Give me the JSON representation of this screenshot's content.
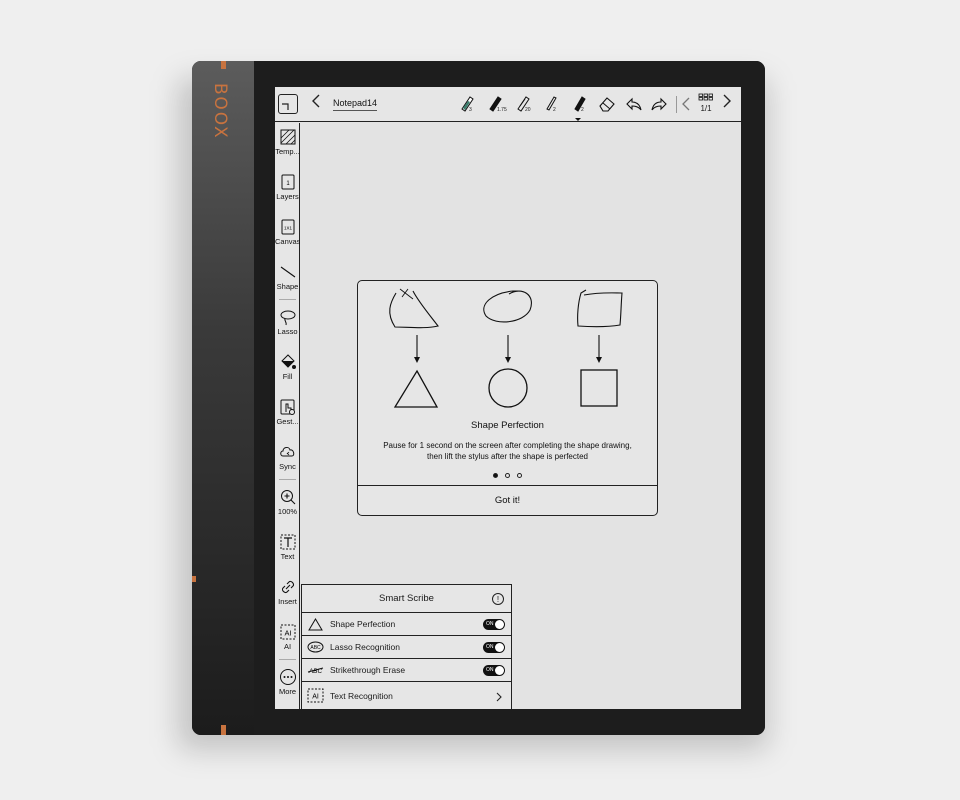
{
  "brand": "BOOX",
  "topbar": {
    "title": "Notepad14",
    "pens": [
      {
        "name": "fountain-pen-icon",
        "width": "3"
      },
      {
        "name": "marker-icon",
        "width": "1.75"
      },
      {
        "name": "pencil-icon",
        "width": "20"
      },
      {
        "name": "brush-pen-icon",
        "width": "2"
      },
      {
        "name": "ballpoint-pen-icon",
        "width": "2",
        "selected": true
      }
    ],
    "page_indicator": "1/1"
  },
  "sidebar": {
    "items": [
      {
        "label": "Temp..."
      },
      {
        "label": "Layers"
      },
      {
        "label": "Canvas"
      },
      {
        "label": "Shape"
      },
      {
        "label": "Lasso"
      },
      {
        "label": "Fill"
      },
      {
        "label": "Gest..."
      },
      {
        "label": "Sync"
      },
      {
        "label": "100%"
      },
      {
        "label": "Text"
      },
      {
        "label": "Insert"
      },
      {
        "label": "AI"
      },
      {
        "label": "More"
      }
    ],
    "canvas_icon_text": "1X1",
    "layers_icon_text": "1"
  },
  "dialog": {
    "title": "Shape Perfection",
    "description": "Pause for 1 second on the screen after completing the shape drawing, then lift the stylus after the shape is perfected",
    "page_count": 3,
    "active_page": 1,
    "button": "Got it!"
  },
  "scribe": {
    "title": "Smart Scribe",
    "info_glyph": "!",
    "rows": [
      {
        "label": "Shape Perfection",
        "icon_text": "",
        "toggle": "ON"
      },
      {
        "label": "Lasso Recognition",
        "icon_text": "ABC",
        "toggle": "ON"
      },
      {
        "label": "Strikethrough Erase",
        "icon_text": "ABC",
        "toggle": "ON"
      },
      {
        "label": "Text Recognition",
        "icon_text": "AI",
        "toggle": null
      }
    ]
  },
  "colors": {
    "accent": "#c8733f",
    "screen": "#e3e3e3",
    "ink": "#111111"
  }
}
